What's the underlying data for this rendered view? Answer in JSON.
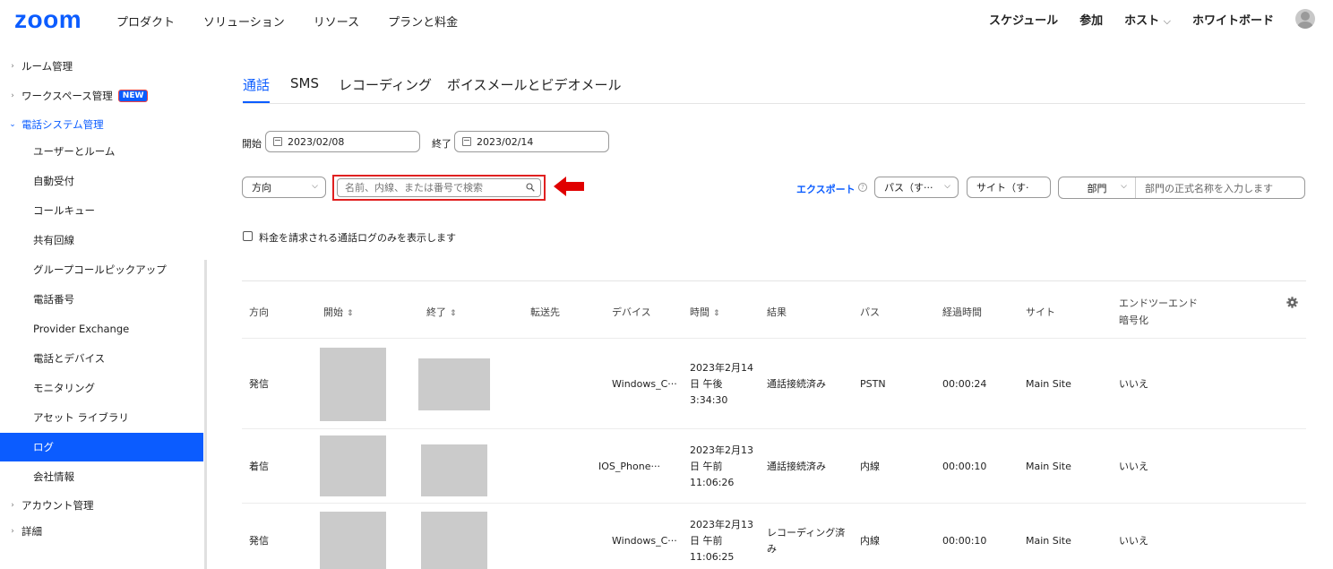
{
  "header": {
    "logo": "zoom",
    "nav_left": [
      "プロダクト",
      "ソリューション",
      "リソース",
      "プランと料金"
    ],
    "nav_right": [
      "スケジュール",
      "参加",
      "ホスト",
      "ホワイトボード"
    ],
    "host_caret": "⌵"
  },
  "sidebar": {
    "items": [
      {
        "label": "ルーム管理",
        "level": "top",
        "state": "collapsed"
      },
      {
        "label": "ワークスペース管理",
        "level": "top",
        "state": "collapsed",
        "badge": "NEW"
      },
      {
        "label": "電話システム管理",
        "level": "top",
        "state": "expanded"
      },
      {
        "label": "ユーザーとルーム",
        "level": "sub"
      },
      {
        "label": "自動受付",
        "level": "sub"
      },
      {
        "label": "コールキュー",
        "level": "sub"
      },
      {
        "label": "共有回線",
        "level": "sub"
      },
      {
        "label": "グループコールピックアップ",
        "level": "sub"
      },
      {
        "label": "電話番号",
        "level": "sub"
      },
      {
        "label": "Provider Exchange",
        "level": "sub"
      },
      {
        "label": "電話とデバイス",
        "level": "sub"
      },
      {
        "label": "モニタリング",
        "level": "sub"
      },
      {
        "label": "アセット ライブラリ",
        "level": "sub"
      },
      {
        "label": "ログ",
        "level": "sub",
        "active": true
      },
      {
        "label": "会社情報",
        "level": "sub"
      },
      {
        "label": "アカウント管理",
        "level": "top",
        "state": "collapsed"
      },
      {
        "label": "詳細",
        "level": "top",
        "state": "collapsed"
      }
    ]
  },
  "tabs": [
    "通話",
    "SMS",
    "レコーディング",
    "ボイスメールとビデオメール"
  ],
  "active_tab": "通話",
  "dates": {
    "start_label": "開始",
    "start_value": "2023/02/08",
    "end_label": "終了",
    "end_value": "2023/02/14"
  },
  "filters": {
    "direction": "方向",
    "search_placeholder": "名前、内線、または番号で検索",
    "export": "エクスポート",
    "help": "?",
    "path": "パス（す···",
    "site": "サイト（す·",
    "dept": "部門",
    "dept_placeholder": "部門の正式名称を入力します"
  },
  "checkbox_label": "料金を請求される通話ログのみを表示します",
  "table": {
    "headers": [
      "方向",
      "開始",
      "終了",
      "転送先",
      "デバイス",
      "時間",
      "結果",
      "パス",
      "経過時間",
      "サイト",
      "エンドツーエンド",
      "暗号化"
    ],
    "rows": [
      {
        "direction": "発信",
        "device": "Windows_C···",
        "time1": "2023年2月14",
        "time2": "日 午後",
        "time3": "3:34:30",
        "result1": "通話接続済み",
        "result2": "",
        "path": "PSTN",
        "duration": "00:00:24",
        "site": "Main Site",
        "e2e": "いいえ"
      },
      {
        "direction": "着信",
        "device": "IOS_Phone···",
        "time1": "2023年2月13",
        "time2": "日 午前",
        "time3": "11:06:26",
        "result1": "通話接続済み",
        "result2": "",
        "path": "内線",
        "duration": "00:00:10",
        "site": "Main Site",
        "e2e": "いいえ"
      },
      {
        "direction": "発信",
        "device": "Windows_C···",
        "time1": "2023年2月13",
        "time2": "日 午前",
        "time3": "11:06:25",
        "result1": "レコーディング済",
        "result2": "み",
        "path": "内線",
        "duration": "00:00:10",
        "site": "Main Site",
        "e2e": "いいえ"
      }
    ]
  },
  "colors": {
    "accent": "#0b5cff",
    "highlight": "#e02020"
  }
}
